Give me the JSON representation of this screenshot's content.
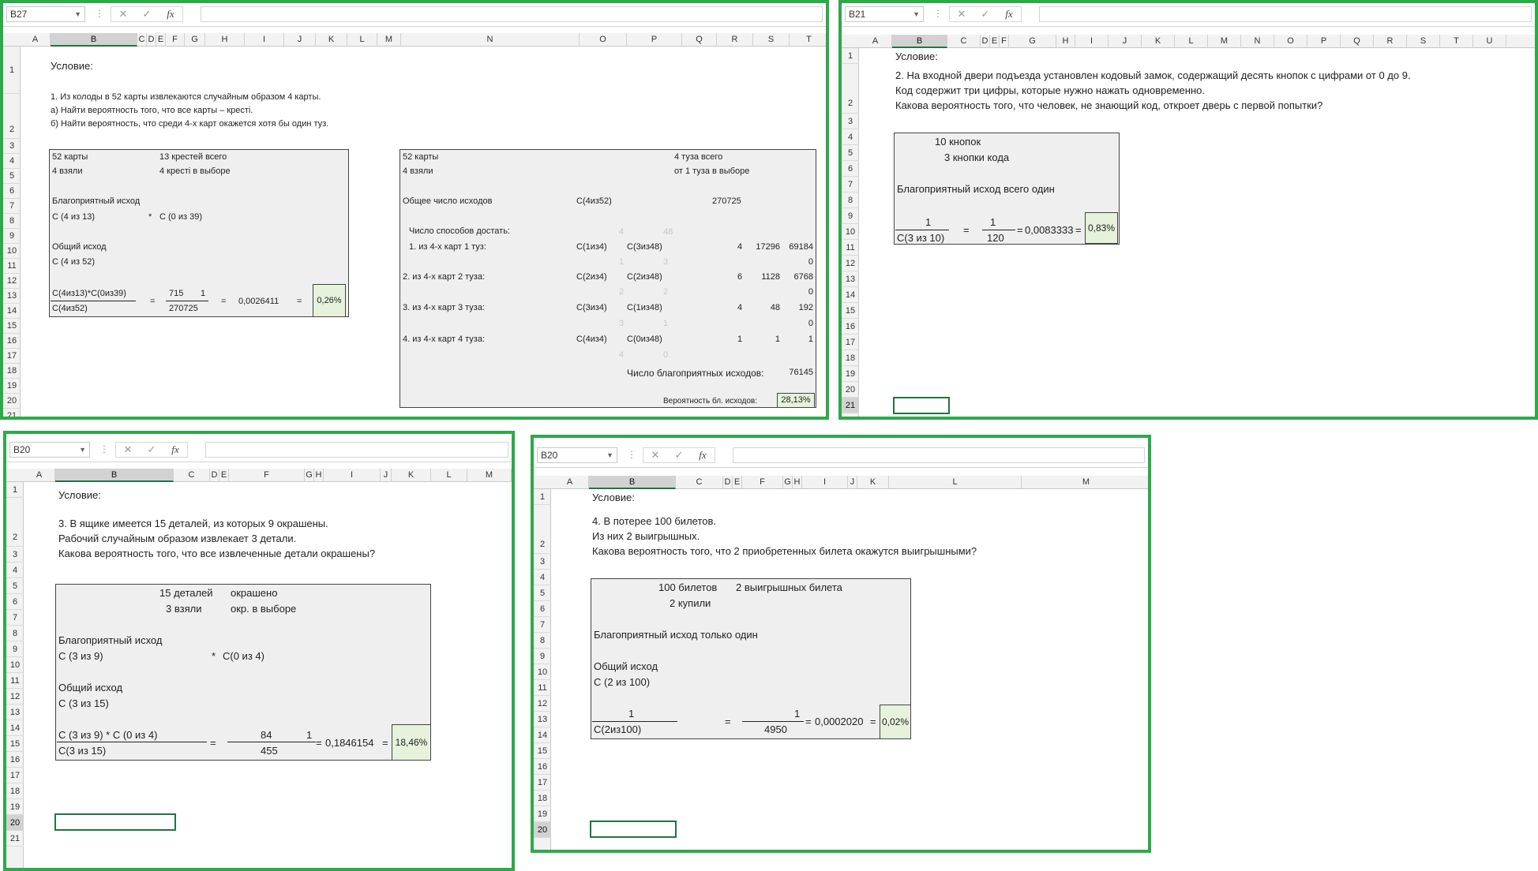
{
  "colors": {
    "frame": "#2ea94a",
    "result_fill": "#e6f2dc",
    "box_fill": "#efefef",
    "selection": "#217346"
  },
  "icons": {
    "cancel": "close-icon",
    "confirm": "check-icon",
    "function": "fx-icon",
    "dropdown": "chevron-down-icon"
  },
  "p1": {
    "namebox": "B27",
    "selected_col": "B",
    "cols": [
      "A",
      "B",
      "C",
      "D",
      "E",
      "F",
      "G",
      "H",
      "I",
      "J",
      "K",
      "L",
      "M",
      "N",
      "O",
      "P",
      "Q",
      "R",
      "S",
      "T"
    ],
    "rows": [
      "1",
      "2",
      "3",
      "4",
      "5",
      "6",
      "7",
      "8",
      "9",
      "10",
      "11",
      "12",
      "13",
      "14",
      "15",
      "16",
      "17",
      "18",
      "19",
      "20",
      "21"
    ],
    "cond_title": "Условие:",
    "cond1": "1. Из колоды в 52 карты извлекаются случайным образом 4 карты.",
    "cond2": "а) Найти вероятность того, что все карты – кресті.",
    "cond3": "б) Найти вероятность, что среди 4-х карт окажется хотя бы один туз.",
    "a": {
      "cards": "52 карты",
      "clubs": "13 крестей всего",
      "took": "4 взяли",
      "clubs_sel": "4 кресті в выборе",
      "fav_title": "Благоприятный исход",
      "fav_f1": "С (4 из 13)",
      "mult": "*",
      "fav_f2": "С (0 из 39)",
      "tot_title": "Общий исход",
      "tot_f": "С (4 из 52)",
      "num_f": "С(4из13)*С(0из39)",
      "den_f": "С(4из52)",
      "eq1": "=",
      "num1": "715",
      "num2": "1",
      "den1": "270725",
      "eq2": "=",
      "dec": "0,0026411",
      "eq3": "=",
      "result": "0,26%"
    },
    "b": {
      "cards": "52 карты",
      "aces": "4 туза всего",
      "took": "4 взяли",
      "aces_sel": "от 1 туза в выборе",
      "total_label": "Общее число исходов",
      "total_f": "С(4из52)",
      "total_v": "270725",
      "ways": "Число способов достать:",
      "rows": [
        {
          "l": "1. из 4-х карт 1 туз:",
          "f1": "С(1из4)",
          "f2": "С(3из48)",
          "v1": "4",
          "v2": "17296",
          "v3": "69184",
          "hint1": "1",
          "hint2": "3",
          "zero": "0"
        },
        {
          "l": "2. из 4-х карт 2 туза:",
          "f1": "С(2из4)",
          "f2": "С(2из48)",
          "v1": "6",
          "v2": "1128",
          "v3": "6768",
          "hint1": "2",
          "hint2": "2",
          "zero": "0"
        },
        {
          "l": "3. из 4-х карт 3 туза:",
          "f1": "С(3из4)",
          "f2": "С(1из48)",
          "v1": "4",
          "v2": "48",
          "v3": "192",
          "hint1": "3",
          "hint2": "1",
          "zero": "0"
        },
        {
          "l": "4. из 4-х карт 4 туза:",
          "f1": "С(4из4)",
          "f2": "С(0из48)",
          "v1": "1",
          "v2": "1",
          "v3": "1",
          "hint1": "4",
          "hint2": "0"
        }
      ],
      "hint_top1": "4",
      "hint_top2": "48",
      "fav_label": "Число благоприятных исходов:",
      "fav_v": "76145",
      "prob_label": "Вероятность бл. исходов:",
      "result": "28,13%"
    }
  },
  "p2": {
    "namebox": "B21",
    "selected_col": "B",
    "selected_row": "21",
    "cols": [
      "A",
      "B",
      "C",
      "D",
      "E",
      "F",
      "G",
      "H",
      "I",
      "J",
      "K",
      "L",
      "M",
      "N",
      "O",
      "P",
      "Q",
      "R",
      "S",
      "T",
      "U"
    ],
    "rows": [
      "1",
      "2",
      "3",
      "4",
      "5",
      "6",
      "7",
      "8",
      "9",
      "10",
      "11",
      "12",
      "13",
      "14",
      "15",
      "16",
      "17",
      "18",
      "19",
      "20",
      "21"
    ],
    "cond_title": "Условие:",
    "cond1": "2. На входной двери подъезда установлен кодовый замок, содержащий десять кнопок с цифрами от 0 до 9.",
    "cond2": "Код содержит три цифры, которые нужно нажать одновременно.",
    "cond3": "Какова вероятность того, что человек, не знающий код, откроет дверь с первой попытки?",
    "l1": "10 кнопок",
    "l2": "3 кнопки кода",
    "fav": "Благоприятный исход всего один",
    "num1": "1",
    "den1": "С(3 из 10)",
    "eq1": "=",
    "num2": "1",
    "den2": "120",
    "eq2": "=",
    "dec": "0,0083333",
    "eq3": "=",
    "result": "0,83%"
  },
  "p3": {
    "namebox": "B20",
    "selected_col": "B",
    "selected_row": "20",
    "cols": [
      "A",
      "B",
      "C",
      "D",
      "E",
      "F",
      "G",
      "H",
      "I",
      "J",
      "K",
      "L",
      "M"
    ],
    "rows": [
      "1",
      "2",
      "3",
      "4",
      "5",
      "6",
      "7",
      "8",
      "9",
      "10",
      "11",
      "12",
      "13",
      "14",
      "15",
      "16",
      "17",
      "18",
      "19",
      "20",
      "21"
    ],
    "cond_title": "Условие:",
    "cond1": "3. В ящике имеется 15 деталей, из которых 9 окрашены.",
    "cond2": "Рабочий случайным образом извлекает 3 детали.",
    "cond3": "Какова вероятность того, что все извлеченные детали окрашены?",
    "l1a": "15 деталей",
    "l1b": "окрашено",
    "l2a": "3 взяли",
    "l2b": "окр. в выборе",
    "fav_title": "Благоприятный исход",
    "fav_f1": "С (3 из 9)",
    "mult": "*",
    "fav_f2": "С(0 из 4)",
    "tot_title": "Общий исход",
    "tot_f": "С (3 из 15)",
    "num_f": "С  (3 из 9)  *  С  (0 из 4)",
    "den_f": "С(3 из 15)",
    "eq1": "=",
    "num1": "84",
    "num2": "1",
    "den1": "455",
    "eq2": "=",
    "dec": "0,1846154",
    "eq3": "=",
    "result": "18,46%"
  },
  "p4": {
    "namebox": "B20",
    "selected_col": "B",
    "selected_row": "20",
    "cols": [
      "A",
      "B",
      "C",
      "D",
      "E",
      "F",
      "G",
      "H",
      "I",
      "J",
      "K",
      "L",
      "M"
    ],
    "rows": [
      "1",
      "2",
      "3",
      "4",
      "5",
      "6",
      "7",
      "8",
      "9",
      "10",
      "11",
      "12",
      "13",
      "14",
      "15",
      "16",
      "17",
      "18",
      "19",
      "20"
    ],
    "cond_title": "Условие:",
    "cond1": "4. В потерее 100 билетов.",
    "cond2": "Из них 2 выигрышных.",
    "cond3": "Какова вероятность того, что 2 приобретенных билета окажутся выигрышными?",
    "l1a": "100 билетов",
    "l1b": "2 выигрышных билета",
    "l2a": "2 купили",
    "fav": "Благоприятный исход только один",
    "tot_title": "Общий исход",
    "tot_f": "С (2 из 100)",
    "num1": "1",
    "den1": "С(2из100)",
    "eq1": "=",
    "num2": "1",
    "den2": "4950",
    "eq2": "=",
    "dec": "0,0002020",
    "eq3": "=",
    "result": "0,02%"
  }
}
